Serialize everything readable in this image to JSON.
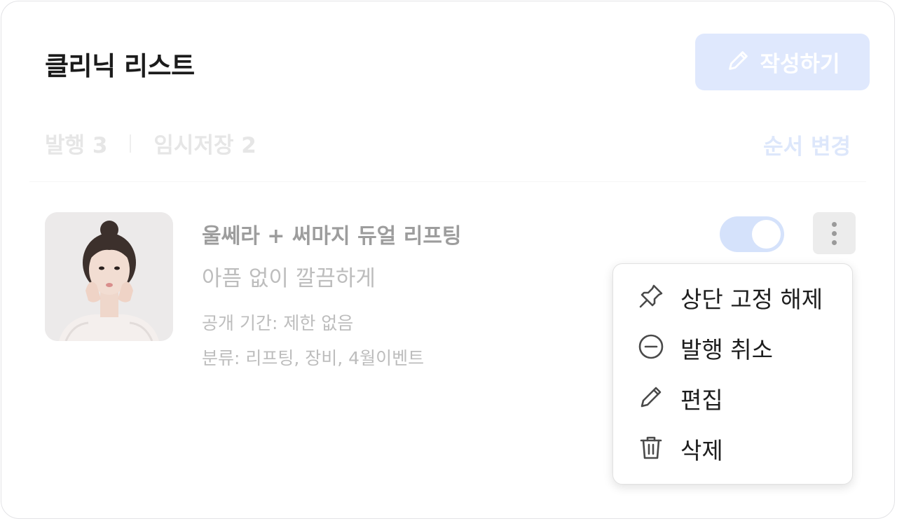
{
  "header": {
    "title": "클리닉 리스트",
    "write_button": "작성하기"
  },
  "tabs": [
    {
      "label": "발행 3"
    },
    {
      "label": "임시저장 2"
    }
  ],
  "reorder_label": "순서 변경",
  "item": {
    "title": "울쎄라 + 써마지 듀얼 리프팅",
    "subtitle": "아픔 없이 깔끔하게",
    "period": "공개 기간: 제한 없음",
    "category": "분류: 리프팅, 장비, 4월이벤트",
    "toggle_on": true
  },
  "context_menu": [
    {
      "label": "상단 고정 해제",
      "icon": "pin-icon"
    },
    {
      "label": "발행 취소",
      "icon": "minus-circle-icon"
    },
    {
      "label": "편집",
      "icon": "pencil-icon"
    },
    {
      "label": "삭제",
      "icon": "trash-icon"
    }
  ],
  "colors": {
    "accent_light": "#dfe8fd",
    "toggle": "#d5e2fb",
    "text_dark": "#1b1b1b",
    "text_muted": "#bdbdbd"
  }
}
